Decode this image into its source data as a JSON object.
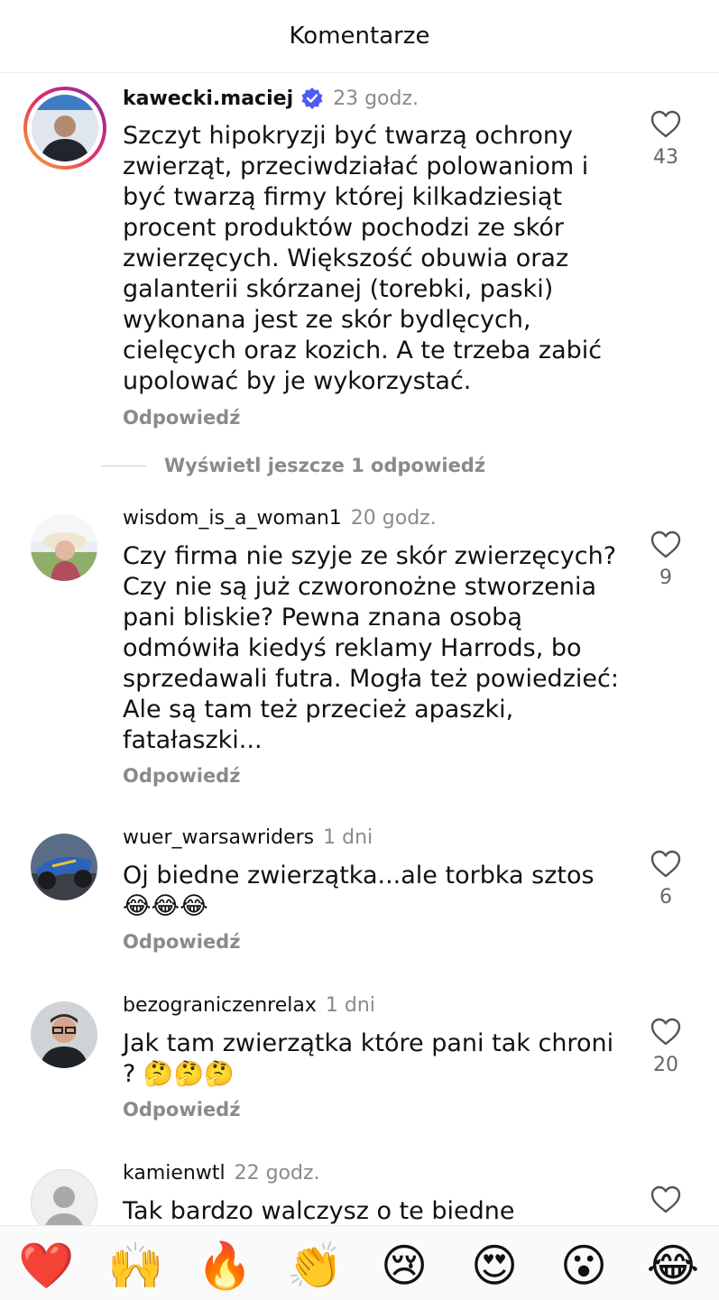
{
  "header": {
    "title": "Komentarze"
  },
  "comments": [
    {
      "username": "kawecki.maciej",
      "verified": true,
      "time": "23 godz.",
      "text": "Szczyt hipokryzji być twarzą ochrony zwierząt, przeciwdziałać polowaniom i być twarzą firmy której kilkadziesiąt procent produktów pochodzi ze skór zwierzęcych. Większość obuwia oraz galanterii skórzanej (torebki, paski) wykonana jest ze skór bydlęcych, cielęcych oraz kozich. A te trzeba zabić upolować by je wykorzystać.",
      "reply_label": "Odpowiedź",
      "likes": "43"
    },
    {
      "username": "wisdom_is_a_woman1",
      "time": "20 godz.",
      "text": "Czy firma nie szyje ze skór zwierzęcych? Czy nie są już czworonożne stworzenia pani bliskie? Pewna znana osobą odmówiła kiedyś reklamy Harrods, bo sprzedawali futra. Mogła też powiedzieć: Ale są tam też przecież apaszki, fatałaszki...",
      "reply_label": "Odpowiedź",
      "likes": "9"
    },
    {
      "username": "wuer_warsawriders",
      "time": "1 dni",
      "text": "Oj biedne zwierzątka...ale torbka sztos 😂😂😂",
      "reply_label": "Odpowiedź",
      "likes": "6"
    },
    {
      "username": "bezograniczenrelax",
      "time": "1 dni",
      "text": "Jak tam zwierzątka które pani tak chroni ? 🤔🤔🤔",
      "reply_label": "Odpowiedź",
      "likes": "20"
    },
    {
      "username": "kamienwtl",
      "time": "22 godz.",
      "text": "Tak bardzo walczysz o te biedne"
    }
  ],
  "more_replies": {
    "label": "Wyświetl jeszcze 1 odpowiedź"
  },
  "emoji_bar": [
    "❤️",
    "🙌",
    "🔥",
    "👏",
    "😢",
    "😍",
    "😮",
    "😂"
  ],
  "colors": {
    "verified": "#4f5bf5",
    "secondary_text": "#8a8a8a",
    "story_ring": "#e1306c"
  }
}
